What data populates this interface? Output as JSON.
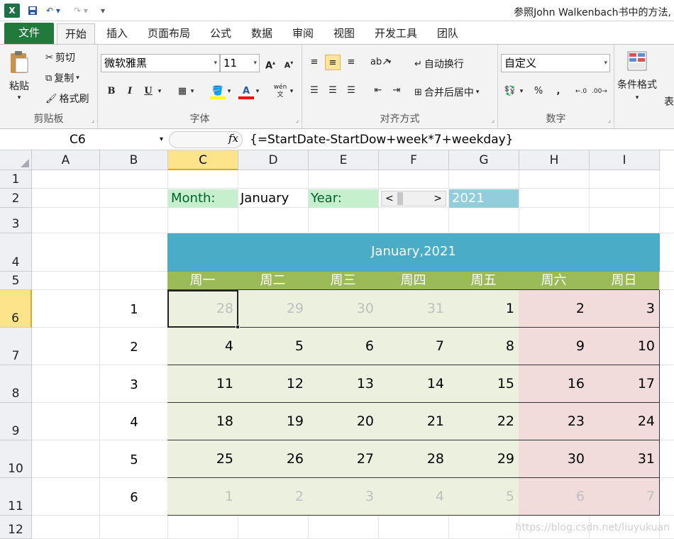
{
  "window": {
    "title": "参照John Walkenbach书中的方法,"
  },
  "quick_access": {
    "save_icon": "save-icon",
    "undo_icon": "undo-icon",
    "redo_icon": "redo-icon"
  },
  "tabs": [
    {
      "label": "文件"
    },
    {
      "label": "开始"
    },
    {
      "label": "插入"
    },
    {
      "label": "页面布局"
    },
    {
      "label": "公式"
    },
    {
      "label": "数据"
    },
    {
      "label": "审阅"
    },
    {
      "label": "视图"
    },
    {
      "label": "开发工具"
    },
    {
      "label": "团队"
    }
  ],
  "ribbon": {
    "clipboard": {
      "paste": "粘贴",
      "cut": "剪切",
      "copy": "复制",
      "format_painter": "格式刷",
      "group": "剪贴板"
    },
    "font": {
      "name": "微软雅黑",
      "size": "11",
      "group": "字体",
      "bold": "B",
      "italic": "I",
      "underline": "U",
      "grow": "A",
      "shrink": "A",
      "color": "A",
      "phonetic": "wén"
    },
    "alignment": {
      "wrap": "自动换行",
      "merge": "合并后居中",
      "group": "对齐方式"
    },
    "number": {
      "format": "自定义",
      "percent": "%",
      "comma": ",",
      "group": "数字"
    },
    "styles": {
      "conditional": "条件格式",
      "more": "表"
    }
  },
  "formula_bar": {
    "name_box": "C6",
    "fx": "fx",
    "formula": "{=StartDate-StartDow+week*7+weekday}"
  },
  "columns": [
    "A",
    "B",
    "C",
    "D",
    "E",
    "F",
    "G",
    "H",
    "I"
  ],
  "rows": [
    "1",
    "2",
    "3",
    "4",
    "5",
    "6",
    "7",
    "8",
    "9",
    "10",
    "11",
    "12"
  ],
  "selected_cell": {
    "column": "C",
    "row": "6"
  },
  "controls": {
    "month_label": "Month:",
    "month_value": "January",
    "year_label": "Year:",
    "year_value": "2021",
    "scroll_left": "<",
    "scroll_right": ">"
  },
  "calendar": {
    "title": "January,2021",
    "weekdays": [
      "周一",
      "周二",
      "周三",
      "周四",
      "周五",
      "周六",
      "周日"
    ],
    "week_numbers": [
      "1",
      "2",
      "3",
      "4",
      "5",
      "6"
    ],
    "weeks": [
      [
        "28",
        "29",
        "30",
        "31",
        "1",
        "2",
        "3"
      ],
      [
        "4",
        "5",
        "6",
        "7",
        "8",
        "9",
        "10"
      ],
      [
        "11",
        "12",
        "13",
        "14",
        "15",
        "16",
        "17"
      ],
      [
        "18",
        "19",
        "20",
        "21",
        "22",
        "23",
        "24"
      ],
      [
        "25",
        "26",
        "27",
        "28",
        "29",
        "30",
        "31"
      ],
      [
        "1",
        "2",
        "3",
        "4",
        "5",
        "6",
        "7"
      ]
    ],
    "other_month": [
      [
        true,
        true,
        true,
        true,
        false,
        false,
        false
      ],
      [
        false,
        false,
        false,
        false,
        false,
        false,
        false
      ],
      [
        false,
        false,
        false,
        false,
        false,
        false,
        false
      ],
      [
        false,
        false,
        false,
        false,
        false,
        false,
        false
      ],
      [
        false,
        false,
        false,
        false,
        false,
        false,
        false
      ],
      [
        true,
        true,
        true,
        true,
        true,
        true,
        true
      ]
    ]
  },
  "watermark": "https://blog.csdn.net/liuyukuan",
  "colors": {
    "excel_green": "#207a3c",
    "header_blue": "#4aacc6",
    "weekday_green": "#9bbb59",
    "label_green_bg": "#c6efce",
    "year_bg": "#92cddc",
    "weekday_fill": "#ebf1de",
    "weekend_fill": "#f2dcdb",
    "selection": "#fde48a"
  }
}
